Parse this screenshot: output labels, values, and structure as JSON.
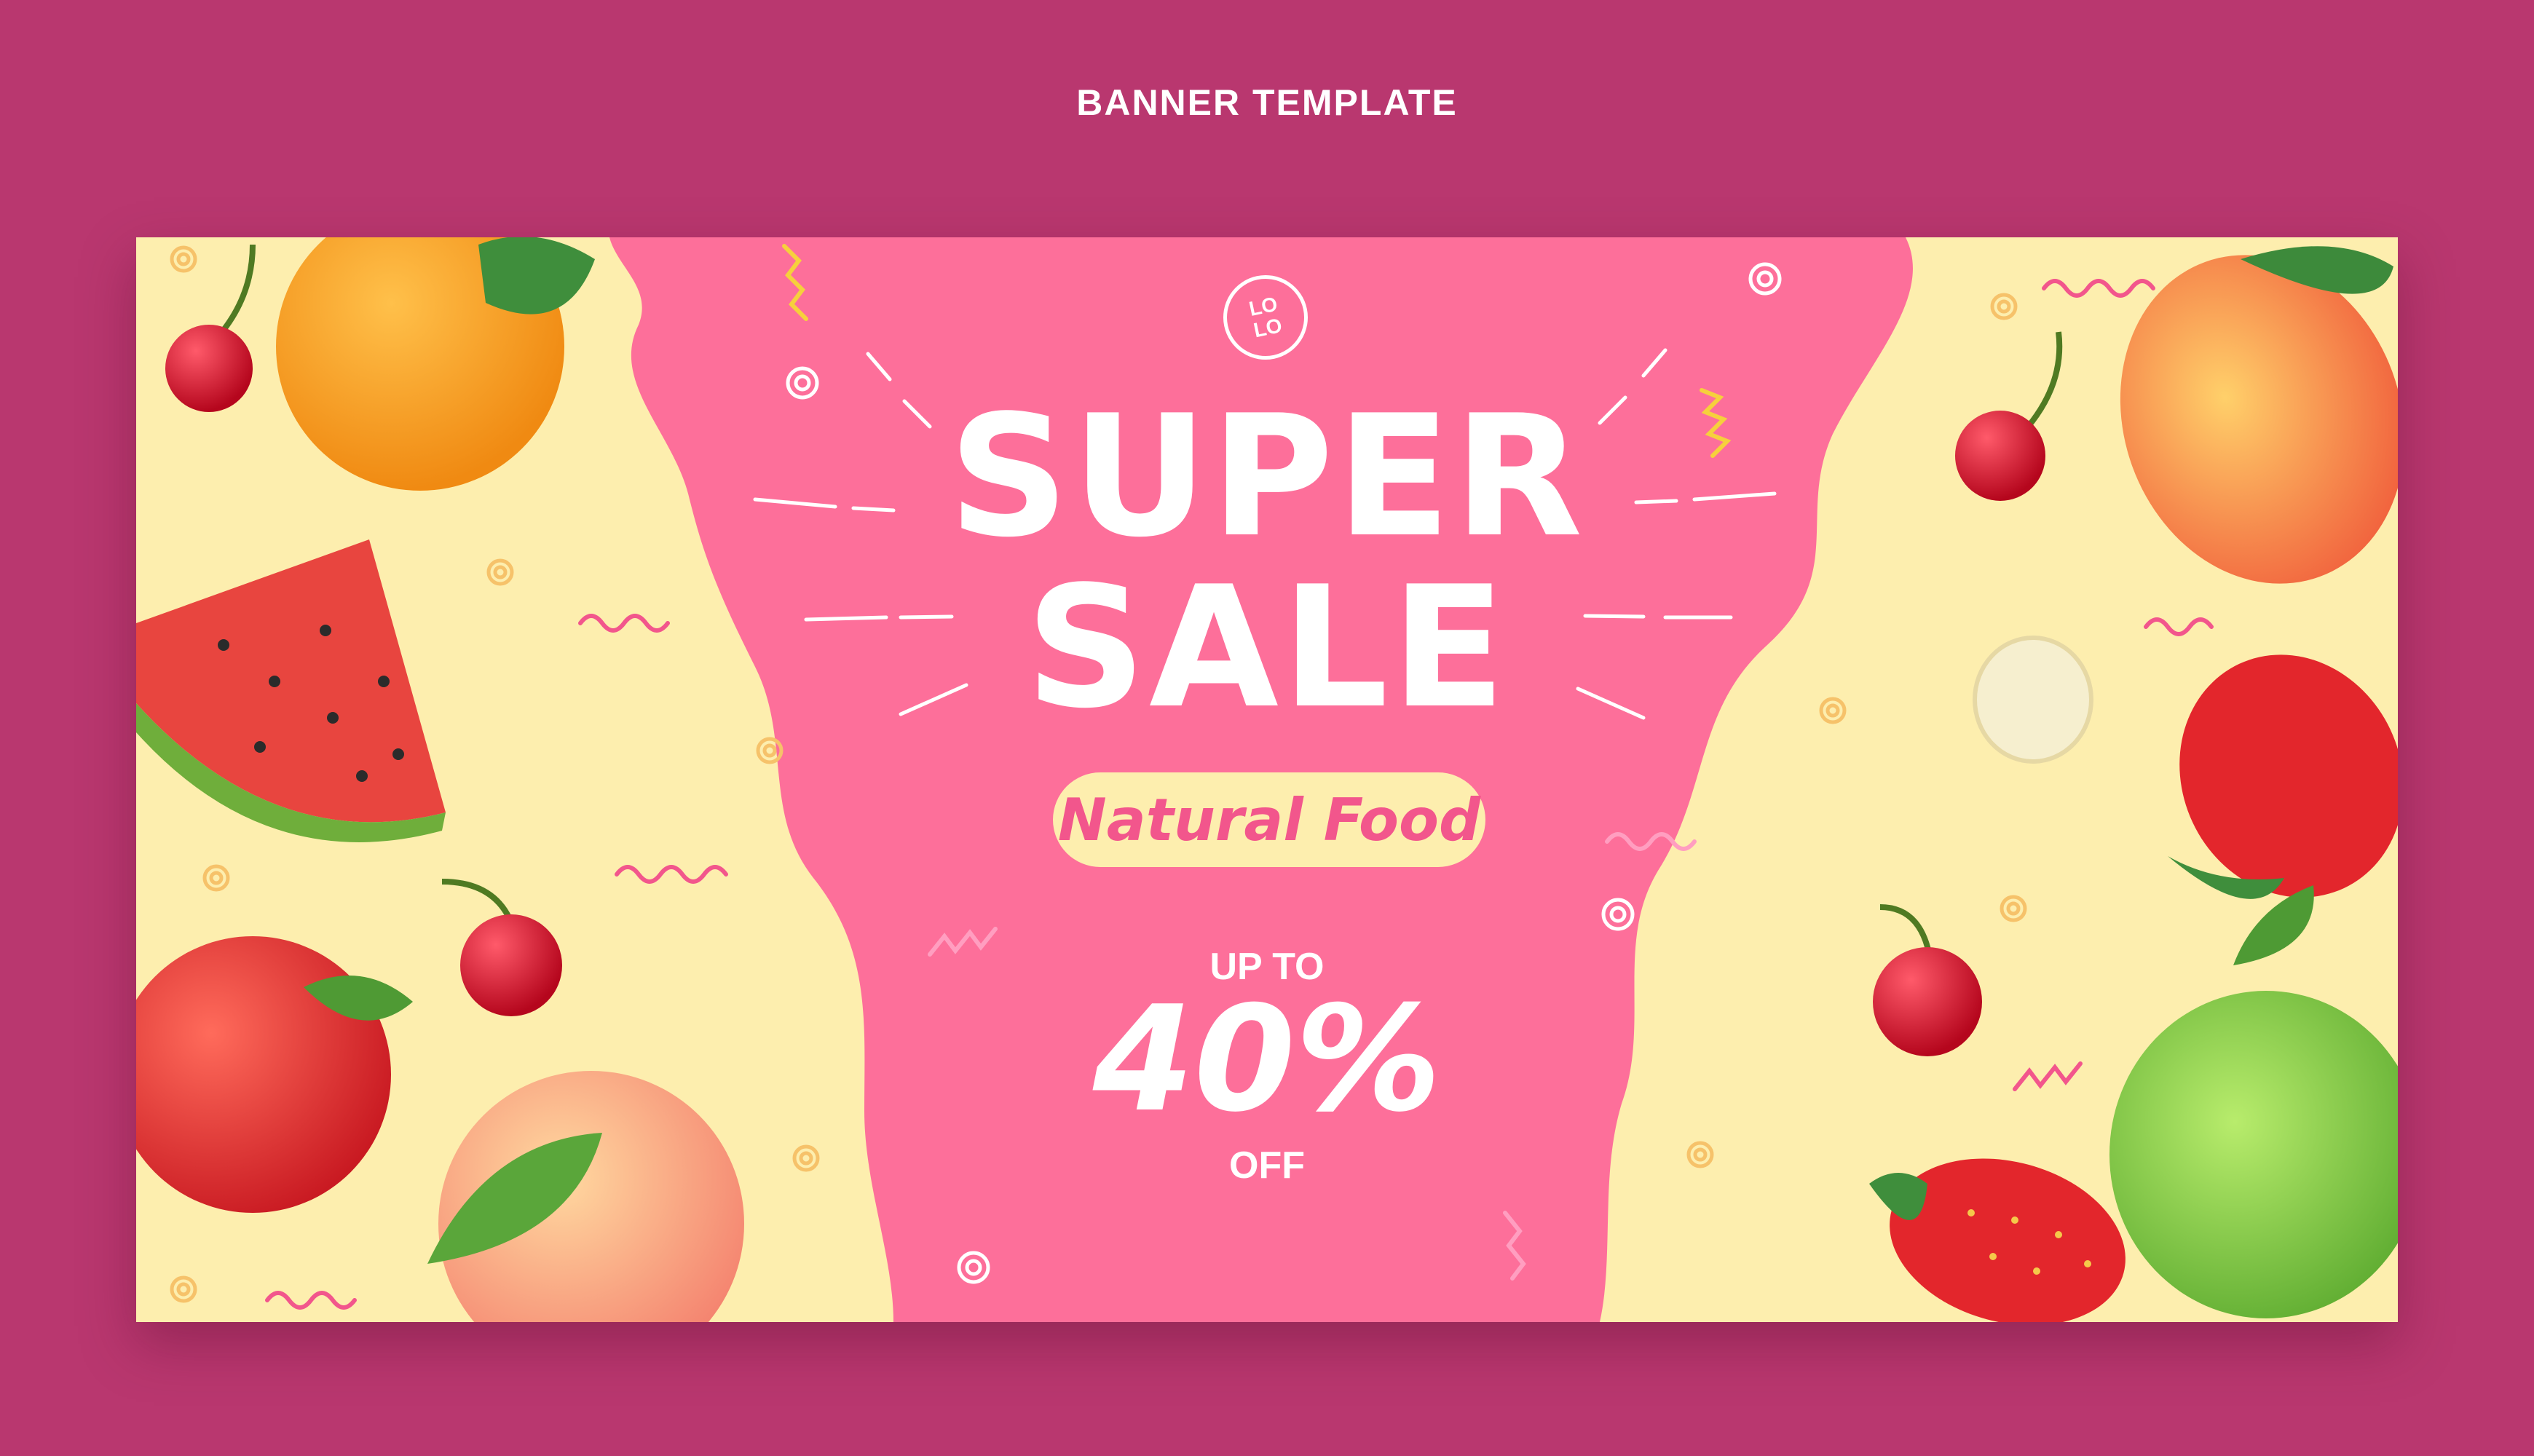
{
  "page_title": "BANNER TEMPLATE",
  "logo": {
    "line1": "LO",
    "line2": "LO"
  },
  "headline": {
    "line1": "SUPER",
    "line2": "SALE"
  },
  "tagline": "Natural Food",
  "offer": {
    "prefix": "UP TO",
    "value": "40%",
    "suffix": "OFF"
  },
  "colors": {
    "page_background": "#b9376f",
    "banner_cream": "#fdeeae",
    "center_pink": "#fd6f9a",
    "accent_pink": "#f2568c"
  },
  "decorations": [
    "orange",
    "cherry",
    "watermelon-slice",
    "red-apple",
    "peach",
    "mango",
    "banana-slice",
    "strawberry",
    "green-apple"
  ]
}
